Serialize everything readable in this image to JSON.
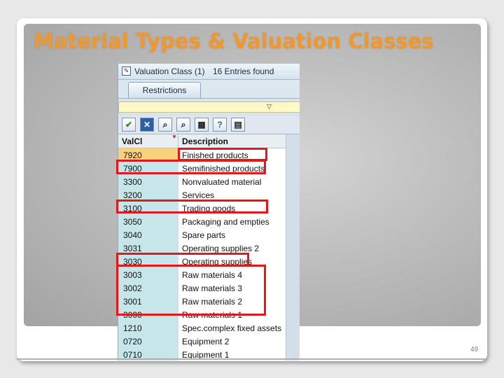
{
  "slide": {
    "title": "Material Types & Valuation Classes",
    "page_number": "49"
  },
  "dialog": {
    "title": "Valuation Class (1)",
    "entries_found": "16 Entries found",
    "tab_label": "Restrictions",
    "toolbar_icons": [
      "check-icon",
      "cancel-icon",
      "find-icon",
      "find-next-icon",
      "select-icon",
      "help-icon",
      "print-icon"
    ],
    "columns": {
      "key": "ValCl",
      "description": "Description"
    },
    "rows": [
      {
        "key": "7920",
        "description": "Finished products",
        "selected": true
      },
      {
        "key": "7900",
        "description": "Semifinished products"
      },
      {
        "key": "3300",
        "description": "Nonvaluated material"
      },
      {
        "key": "3200",
        "description": "Services"
      },
      {
        "key": "3100",
        "description": "Trading goods"
      },
      {
        "key": "3050",
        "description": "Packaging and empties"
      },
      {
        "key": "3040",
        "description": "Spare parts"
      },
      {
        "key": "3031",
        "description": "Operating supplies 2"
      },
      {
        "key": "3030",
        "description": "Operating supplies"
      },
      {
        "key": "3003",
        "description": "Raw materials 4"
      },
      {
        "key": "3002",
        "description": "Raw materials 3"
      },
      {
        "key": "3001",
        "description": "Raw materials 2"
      },
      {
        "key": "3000",
        "description": "Raw materials 1"
      },
      {
        "key": "1210",
        "description": "Spec.complex fixed assets"
      },
      {
        "key": "0720",
        "description": "Equipment 2"
      },
      {
        "key": "0710",
        "description": "Equipment 1"
      }
    ]
  },
  "colors": {
    "title_orange": "#f0982e",
    "highlight_red": "#e01a1a",
    "key_column": "#c6e6ea",
    "selected_cell": "#f7d27d"
  }
}
